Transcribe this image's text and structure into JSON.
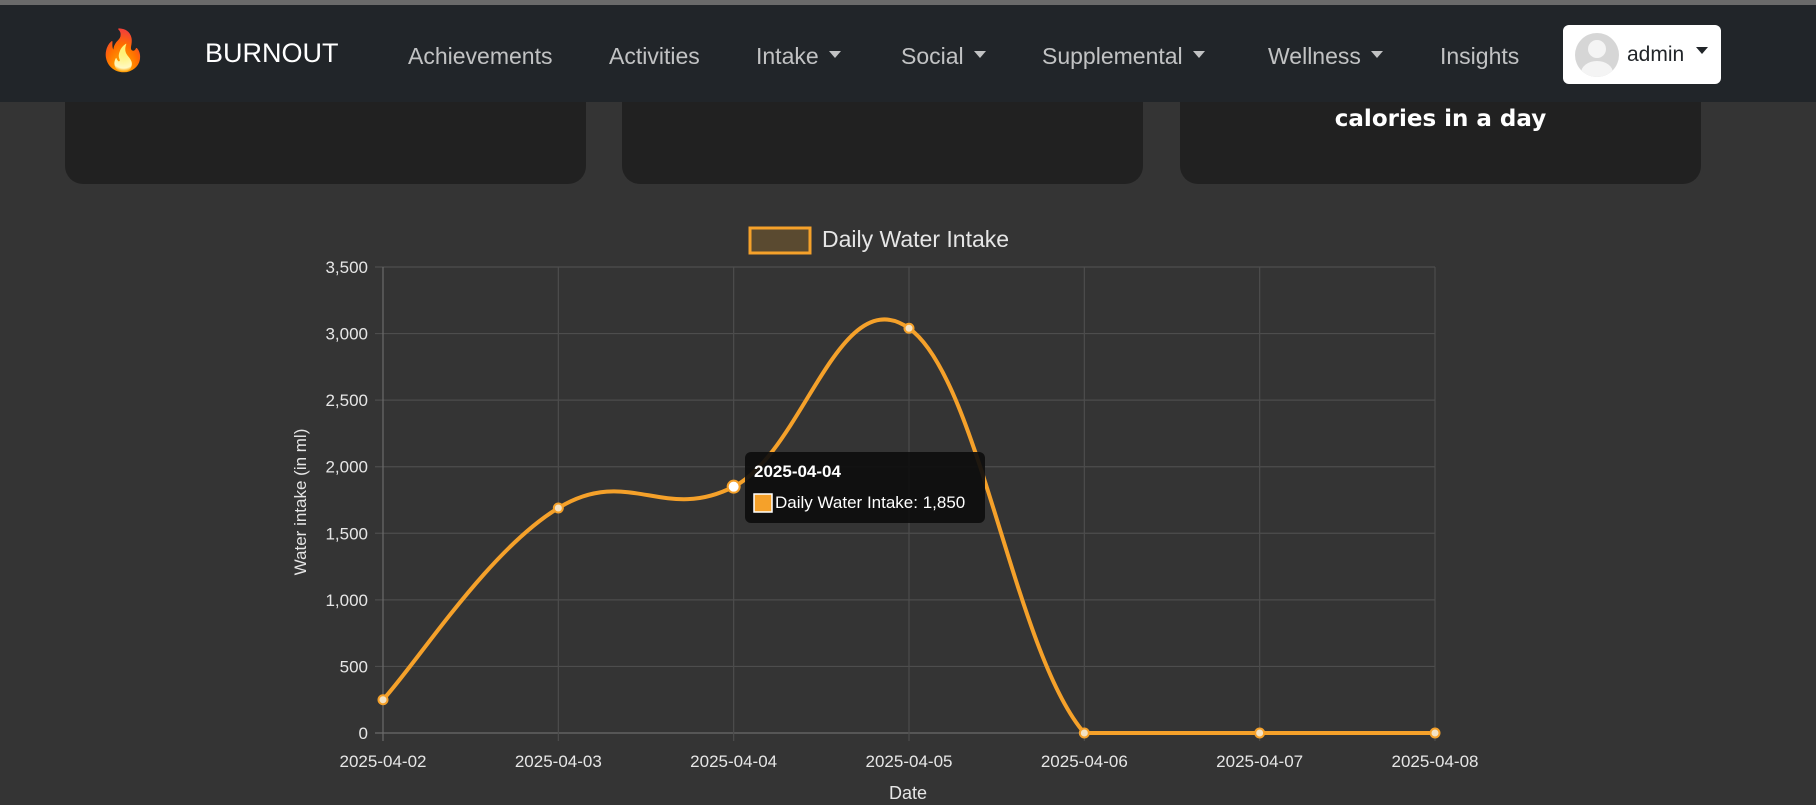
{
  "brand": {
    "icon": "🔥",
    "name": "BURNOUT"
  },
  "nav": {
    "items": [
      {
        "label": "Achievements",
        "dropdown": false
      },
      {
        "label": "Activities",
        "dropdown": false
      },
      {
        "label": "Intake",
        "dropdown": true
      },
      {
        "label": "Social",
        "dropdown": true
      },
      {
        "label": "Supplemental",
        "dropdown": true
      },
      {
        "label": "Wellness",
        "dropdown": true
      },
      {
        "label": "Insights",
        "dropdown": false
      }
    ],
    "user": {
      "name": "admin",
      "icon": "user-avatar-icon"
    }
  },
  "cards": [
    {
      "text": ""
    },
    {
      "text": ""
    },
    {
      "text": "calories in a day"
    }
  ],
  "colors": {
    "background": "#343434",
    "navbar": "#212529",
    "card": "#212121",
    "line": "#f5a12a"
  },
  "chart_data": {
    "type": "line",
    "legend": {
      "label": "Daily Water Intake",
      "placement": "top"
    },
    "xlabel": "Date",
    "ylabel": "Water intake (in ml)",
    "categories": [
      "2025-04-02",
      "2025-04-03",
      "2025-04-04",
      "2025-04-05",
      "2025-04-06",
      "2025-04-07",
      "2025-04-08"
    ],
    "series": [
      {
        "name": "Daily Water Intake",
        "values": [
          250,
          1690,
          1850,
          3040,
          0,
          0,
          0
        ]
      }
    ],
    "ylim": [
      0,
      3500
    ],
    "yticks": [
      "0",
      "500",
      "1,000",
      "1,500",
      "2,000",
      "2,500",
      "3,000",
      "3,500"
    ],
    "grid": true,
    "tooltip": {
      "title": "2025-04-04",
      "label": "Daily Water Intake: 1,850",
      "index": 2
    }
  }
}
